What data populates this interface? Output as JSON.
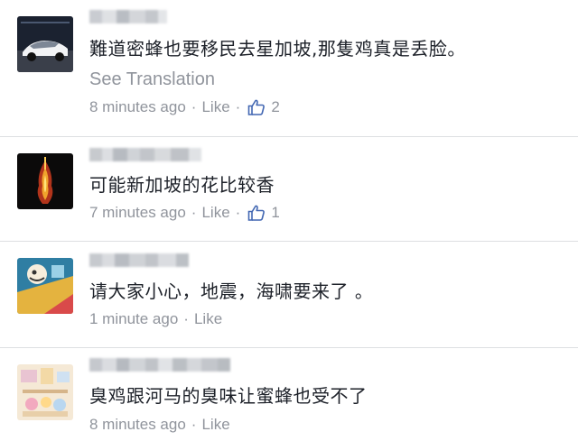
{
  "comments": [
    {
      "text": "難道密蜂也要移民去星加坡,那隻鸡真是丢脸。",
      "translate_label": "See Translation",
      "time": "8 minutes ago",
      "like_label": "Like",
      "like_count": "2"
    },
    {
      "text": "可能新加坡的花比较香",
      "time": "7 minutes ago",
      "like_label": "Like",
      "like_count": "1"
    },
    {
      "text": "请大家小心，地震，海啸要来了 。",
      "time": "1 minute ago",
      "like_label": "Like"
    },
    {
      "text": "臭鸡跟河马的臭味让蜜蜂也受不了",
      "time": "8 minutes ago",
      "like_label": "Like"
    }
  ],
  "separator": "·",
  "colors": {
    "text": "#1d2129",
    "meta": "#90949c",
    "like_blue": "#4267b2",
    "divider": "#dddfe2"
  },
  "icons": {
    "like": "thumbs-up-icon"
  }
}
